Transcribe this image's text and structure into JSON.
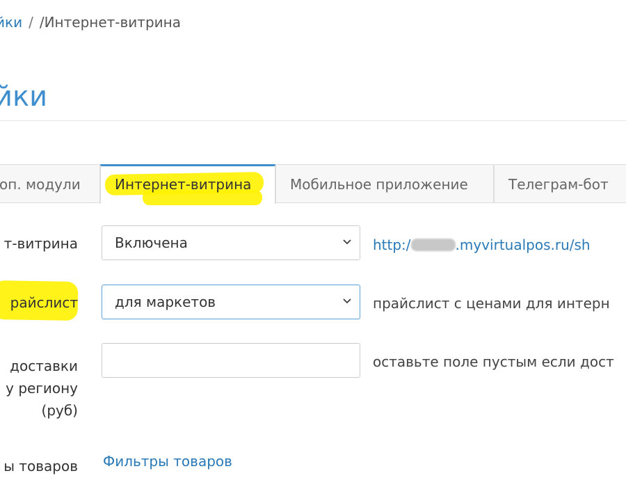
{
  "breadcrumb": {
    "parent": "йки",
    "separator1": "/",
    "current_prefix": "/",
    "current": "Интернет-витрина"
  },
  "page": {
    "title": "йки"
  },
  "tabs": [
    {
      "label": "оп. модули",
      "active": false
    },
    {
      "label": "Интернет-витрина",
      "active": true
    },
    {
      "label": "Мобильное приложение",
      "active": false
    },
    {
      "label": "Телеграм-бот",
      "active": false
    }
  ],
  "form": {
    "storefront": {
      "label": "т-витрина",
      "value": "Включена",
      "link_prefix": "http:/",
      "link_suffix": ".myvirtualpos.ru/sh"
    },
    "pricelist": {
      "label": "райслист",
      "value": "для маркетов",
      "help": "прайслист с ценами для интерн"
    },
    "delivery": {
      "label_lines": [
        "доставки",
        "у региону",
        "(руб)"
      ],
      "value": "",
      "help": "оставьте поле пустым если дост"
    },
    "filters": {
      "label": "ы товаров",
      "link": "Фильтры товаров"
    }
  },
  "colors": {
    "accent": "#3f8fcf",
    "link": "#2a7ab8",
    "highlight": "#fff200"
  }
}
